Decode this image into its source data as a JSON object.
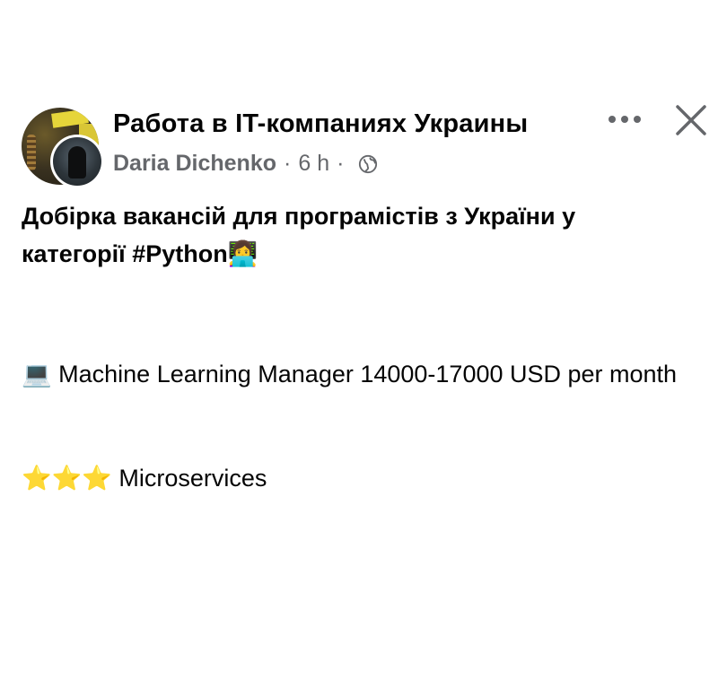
{
  "post": {
    "group_name": "Работа в IT-компаниях Украины",
    "author": "Daria Dichenko",
    "separator": "·",
    "time": "6 h",
    "audience_icon": "globe-icon",
    "headline": "Добірка вакансій для програмістів з України у категорії #Python",
    "headline_emoji": "👩‍💻",
    "job_emoji": "💻",
    "job_text": "Machine Learning Manager 14000-17000 USD per month",
    "tag_emoji": "⭐⭐⭐",
    "tag_text": "Microservices"
  },
  "icons": {
    "more": "more-options-icon",
    "close": "close-icon"
  },
  "colors": {
    "text_primary": "#050505",
    "text_secondary": "#65676b",
    "background": "#ffffff"
  }
}
